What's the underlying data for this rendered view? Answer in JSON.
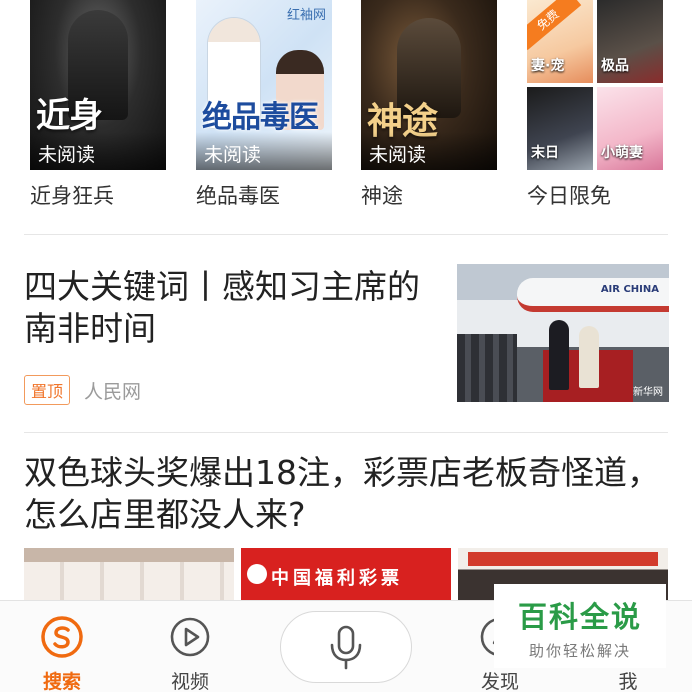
{
  "books": [
    {
      "title": "近身狂兵",
      "cover_text": "近身",
      "badge": "未阅读"
    },
    {
      "title": "绝品毒医",
      "cover_text": "绝品毒医",
      "badge": "未阅读",
      "cover_logo": "红袖网"
    },
    {
      "title": "神途",
      "cover_text": "神途",
      "badge": "未阅读"
    },
    {
      "title": "今日限免",
      "tag": "免费",
      "mini_covers": [
        "妻·宠",
        "极品",
        "末日",
        "小萌妻"
      ]
    }
  ],
  "news": [
    {
      "title": "四大关键词丨感知习主席的南非时间",
      "badge": "置顶",
      "source": "人民网",
      "thumb_text": "AIR CHINA",
      "thumb_watermark": "新华网"
    },
    {
      "title": "双色球头奖爆出18注，彩票店老板奇怪道，怎么店里都没人来?",
      "images": [
        "lottery-tickets",
        "lottery-store-sign",
        "award-event"
      ],
      "store_sign_text": "中国福利彩票"
    }
  ],
  "bottom_nav": {
    "search_label": "搜索",
    "video_label": "视频",
    "discover_label": "发现",
    "me_label": "我"
  },
  "watermark": {
    "title": "百科全说",
    "subtitle": "助你轻松解决"
  },
  "colors": {
    "accent": "#f06a10",
    "badge_border": "#f29a5c",
    "watermark_green": "#2a9b47"
  }
}
